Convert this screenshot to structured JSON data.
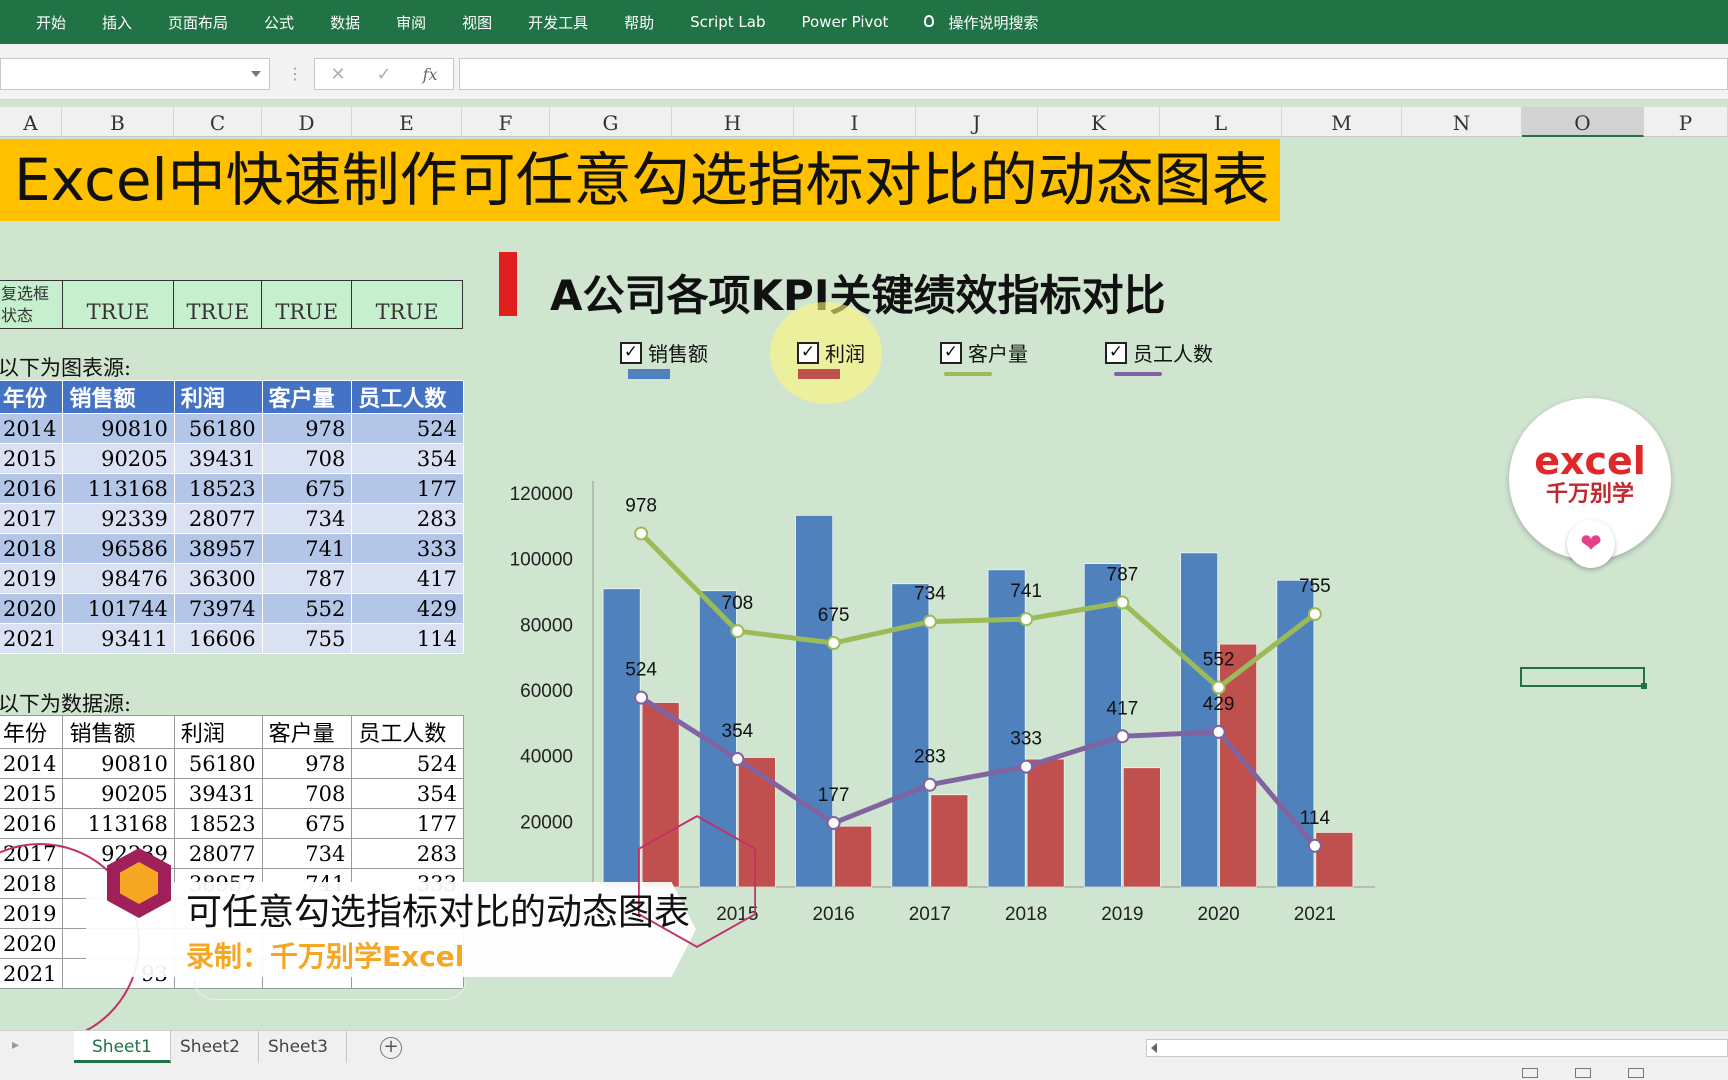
{
  "ribbon": {
    "tabs": [
      "开始",
      "插入",
      "页面布局",
      "公式",
      "数据",
      "审阅",
      "视图",
      "开发工具",
      "帮助",
      "Script Lab",
      "Power Pivot"
    ],
    "search": "操作说明搜索"
  },
  "formula_bar": {
    "cancel": "✕",
    "enter": "✓",
    "fx": "fx"
  },
  "columns": [
    "A",
    "B",
    "C",
    "D",
    "E",
    "F",
    "G",
    "H",
    "I",
    "J",
    "K",
    "L",
    "M",
    "N",
    "O",
    "P"
  ],
  "banner": {
    "title": "Excel中快速制作可任意勾选指标对比的动态图表"
  },
  "checkbox_state": {
    "label": "复选框\n状态",
    "values": [
      "TRUE",
      "TRUE",
      "TRUE",
      "TRUE"
    ]
  },
  "chart_source": {
    "label": "以下为图表源:",
    "headers": [
      "年份",
      "销售额",
      "利润",
      "客户量",
      "员工人数"
    ],
    "rows": [
      [
        "2014",
        "90810",
        "56180",
        "978",
        "524"
      ],
      [
        "2015",
        "90205",
        "39431",
        "708",
        "354"
      ],
      [
        "2016",
        "113168",
        "18523",
        "675",
        "177"
      ],
      [
        "2017",
        "92339",
        "28077",
        "734",
        "283"
      ],
      [
        "2018",
        "96586",
        "38957",
        "741",
        "333"
      ],
      [
        "2019",
        "98476",
        "36300",
        "787",
        "417"
      ],
      [
        "2020",
        "101744",
        "73974",
        "552",
        "429"
      ],
      [
        "2021",
        "93411",
        "16606",
        "755",
        "114"
      ]
    ]
  },
  "data_source": {
    "label": "以下为数据源:",
    "headers": [
      "年份",
      "销售额",
      "利润",
      "客户量",
      "员工人数"
    ],
    "rows": [
      [
        "2014",
        "90810",
        "56180",
        "978",
        "524"
      ],
      [
        "2015",
        "90205",
        "39431",
        "708",
        "354"
      ],
      [
        "2016",
        "113168",
        "18523",
        "675",
        "177"
      ],
      [
        "2017",
        "92339",
        "28077",
        "734",
        "283"
      ],
      [
        "2018",
        "9",
        "38957",
        "741",
        "333"
      ],
      [
        "2019",
        "",
        "",
        "",
        ""
      ],
      [
        "2020",
        "",
        "",
        "",
        ""
      ],
      [
        "2021",
        "93",
        "",
        "",
        ""
      ]
    ]
  },
  "chart": {
    "title": "A公司各项KPI关键绩效指标对比",
    "checkboxes": [
      {
        "label": "销售额",
        "checked": "✓",
        "color": "#4f81bd"
      },
      {
        "label": "利润",
        "checked": "✓",
        "color": "#c0504d"
      },
      {
        "label": "客户量",
        "checked": "✓",
        "color": "#9bbb59"
      },
      {
        "label": "员工人数",
        "checked": "✓",
        "color": "#8064a2"
      }
    ]
  },
  "chart_data": {
    "type": "bar",
    "categories": [
      "2014",
      "2015",
      "2016",
      "2017",
      "2018",
      "2019",
      "2020",
      "2021"
    ],
    "ylim": [
      0,
      120000
    ],
    "yticks": [
      20000,
      40000,
      60000,
      80000,
      100000,
      120000
    ],
    "series": [
      {
        "name": "销售额",
        "kind": "bar",
        "color": "#4f81bd",
        "values": [
          90810,
          90205,
          113168,
          92339,
          96586,
          98476,
          101744,
          93411
        ]
      },
      {
        "name": "利润",
        "kind": "bar",
        "color": "#c0504d",
        "values": [
          56180,
          39431,
          18523,
          28077,
          38957,
          36300,
          73974,
          16606
        ]
      },
      {
        "name": "客户量",
        "kind": "line",
        "color": "#9bbb59",
        "values": [
          978,
          708,
          675,
          734,
          741,
          787,
          552,
          755
        ]
      },
      {
        "name": "员工人数",
        "kind": "line",
        "color": "#8064a2",
        "values": [
          524,
          354,
          177,
          283,
          333,
          417,
          429,
          114
        ]
      }
    ],
    "secondary_axis_max": 1090
  },
  "logo": {
    "line1": "excel",
    "line2": "千万别学",
    "heart": "❤"
  },
  "overlay": {
    "title": "可任意勾选指标对比的动态图表",
    "author": "录制：千万别学Excel"
  },
  "sheets": [
    "Sheet1",
    "Sheet2",
    "Sheet3"
  ],
  "add_sheet": "+"
}
